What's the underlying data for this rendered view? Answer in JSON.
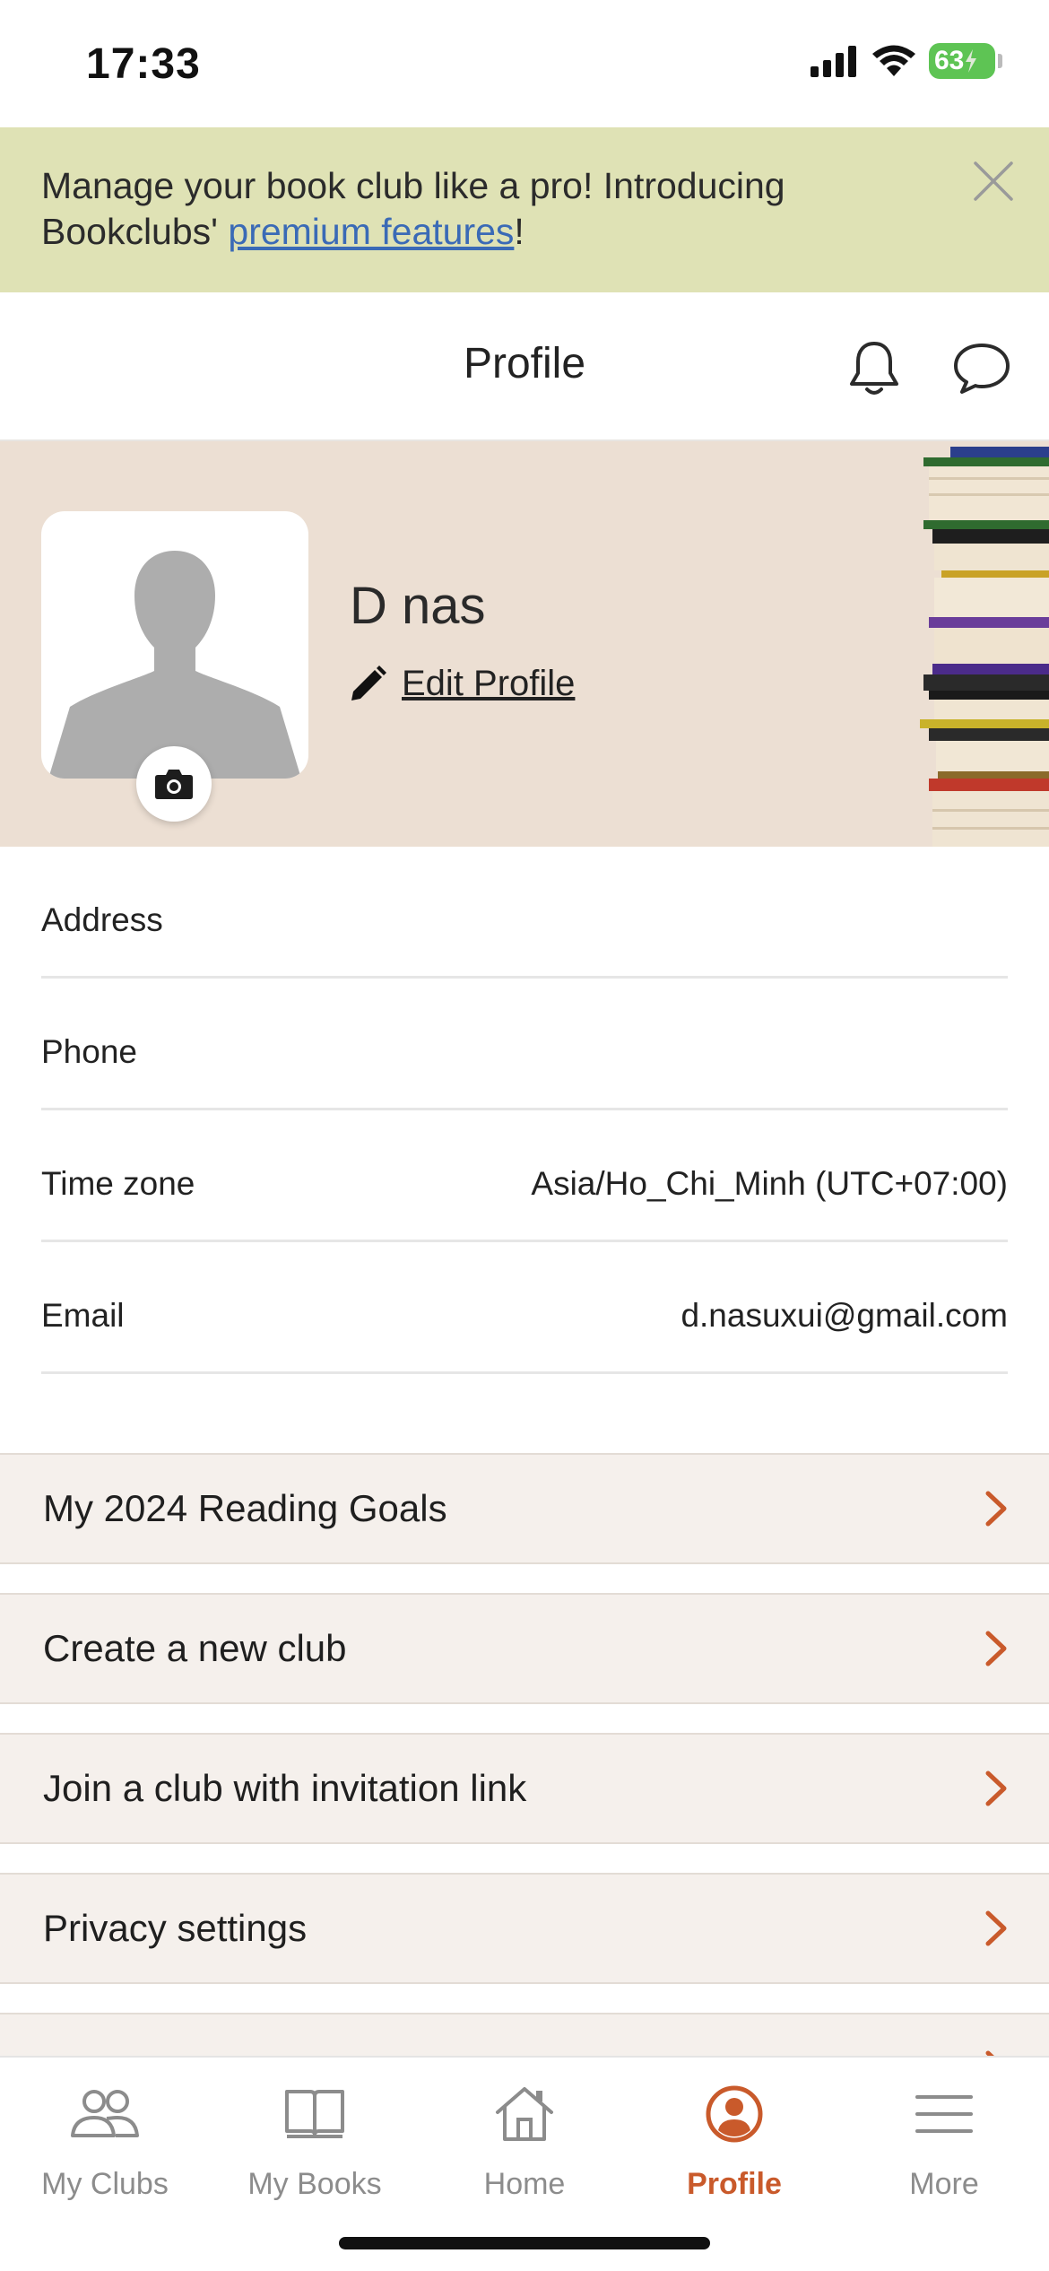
{
  "status_bar": {
    "time": "17:33",
    "battery": "63",
    "icons": [
      "signal-icon",
      "wifi-icon",
      "battery-icon"
    ]
  },
  "promo": {
    "text_before": "Manage your book club like a pro! Introducing Bookclubs' ",
    "link_text": "premium features",
    "text_after": "!",
    "close_icon": "close-icon"
  },
  "header": {
    "title": "Profile",
    "icons": [
      "bell-icon",
      "chat-bubble-icon"
    ]
  },
  "profile": {
    "name": "D nas",
    "edit_label": "Edit Profile",
    "edit_icon": "pencil-icon",
    "camera_icon": "camera-icon"
  },
  "info_rows": [
    {
      "label": "Address",
      "value": ""
    },
    {
      "label": "Phone",
      "value": ""
    },
    {
      "label": "Time zone",
      "value": "Asia/Ho_Chi_Minh (UTC+07:00)"
    },
    {
      "label": "Email",
      "value": "d.nasuxui@gmail.com"
    }
  ],
  "menu": [
    {
      "label": "My 2024 Reading Goals"
    },
    {
      "label": "Create a new club"
    },
    {
      "label": "Join a club with invitation link"
    },
    {
      "label": "Privacy settings"
    },
    {
      "label": ""
    }
  ],
  "tabs": [
    {
      "label": "My Clubs",
      "icon": "people-icon",
      "active": false
    },
    {
      "label": "My Books",
      "icon": "book-icon",
      "active": false
    },
    {
      "label": "Home",
      "icon": "home-icon",
      "active": false
    },
    {
      "label": "Profile",
      "icon": "profile-icon",
      "active": true
    },
    {
      "label": "More",
      "icon": "menu-icon",
      "active": false
    }
  ],
  "colors": {
    "accent": "#c95a2b",
    "promo_bg": "#dfe2b5",
    "hero_bg": "#ecdfd3",
    "menu_bg": "#f5f0ec",
    "link": "#3a6ab6"
  }
}
